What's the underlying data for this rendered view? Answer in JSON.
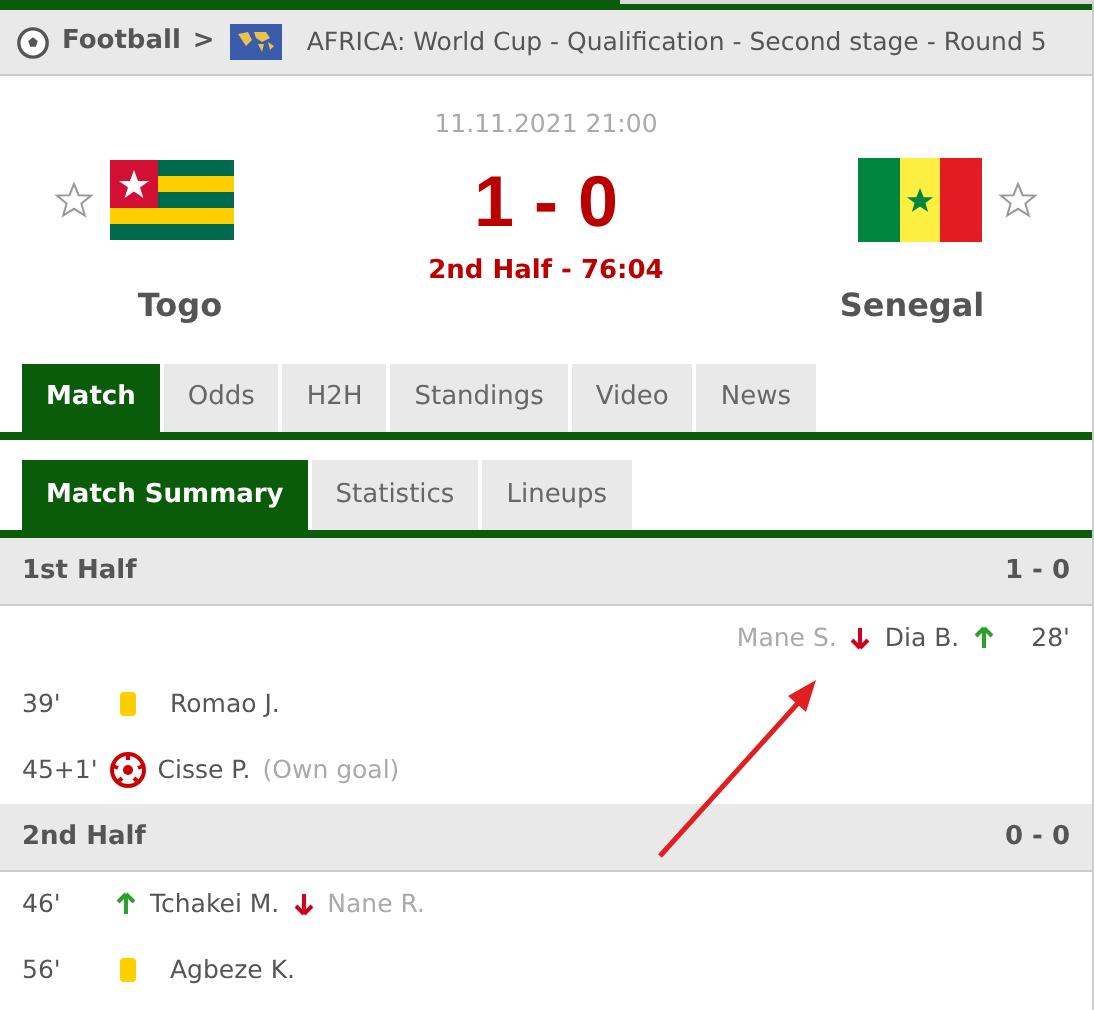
{
  "breadcrumb": {
    "sport": "Football",
    "separator": ">",
    "competition": "AFRICA: World Cup - Qualification - Second stage - Round 5"
  },
  "match": {
    "date": "11.11.2021 21:00",
    "score": "1 - 0",
    "status": "2nd Half - 76:04",
    "home": {
      "name": "Togo",
      "favorite": false
    },
    "away": {
      "name": "Senegal",
      "favorite": false
    }
  },
  "tabs": [
    {
      "label": "Match",
      "selected": true
    },
    {
      "label": "Odds",
      "selected": false
    },
    {
      "label": "H2H",
      "selected": false
    },
    {
      "label": "Standings",
      "selected": false
    },
    {
      "label": "Video",
      "selected": false
    },
    {
      "label": "News",
      "selected": false
    }
  ],
  "subtabs": [
    {
      "label": "Match Summary",
      "selected": true
    },
    {
      "label": "Statistics",
      "selected": false
    },
    {
      "label": "Lineups",
      "selected": false
    }
  ],
  "periods": [
    {
      "title": "1st Half",
      "score": "1 - 0",
      "events": [
        {
          "kind": "substitution_away",
          "minute": "28'",
          "player_in": "Dia B.",
          "player_out": "Mane S."
        },
        {
          "kind": "yellow_card",
          "minute": "39'",
          "player": "Romao J."
        },
        {
          "kind": "own_goal",
          "minute": "45+1'",
          "player": "Cisse P.",
          "note": "(Own goal)"
        }
      ]
    },
    {
      "title": "2nd Half",
      "score": "0 - 0",
      "events": [
        {
          "kind": "substitution_home",
          "minute": "46'",
          "player_in": "Tchakei M.",
          "player_out": "Nane R."
        },
        {
          "kind": "yellow_card",
          "minute": "56'",
          "player": "Agbeze K."
        }
      ]
    }
  ]
}
